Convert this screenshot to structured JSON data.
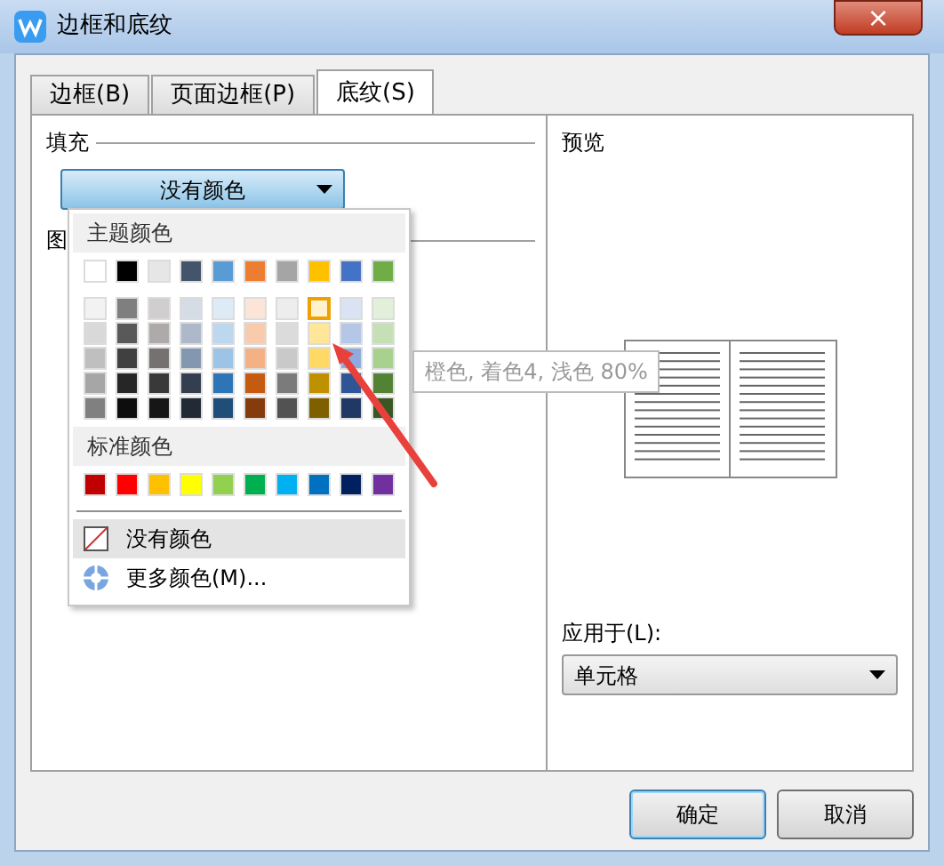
{
  "window": {
    "title": "边框和底纹",
    "close": "×"
  },
  "tabs": [
    {
      "label": "边框(B)",
      "selected": false
    },
    {
      "label": "页面边框(P)",
      "selected": false
    },
    {
      "label": "底纹(S)",
      "selected": true
    }
  ],
  "fill": {
    "label": "填充",
    "dropdown": "没有颜色"
  },
  "pattern": {
    "label": "图"
  },
  "color_menu": {
    "theme_heading": "主题颜色",
    "theme_colors": [
      {
        "color": "#ffffff"
      },
      {
        "color": "#000000"
      },
      {
        "color": "#e7e6e6"
      },
      {
        "color": "#44546a"
      },
      {
        "color": "#5b9bd5"
      },
      {
        "color": "#ed7d31"
      },
      {
        "color": "#a5a5a5"
      },
      {
        "color": "#ffc000"
      },
      {
        "color": "#4472c4"
      },
      {
        "color": "#70ad47"
      }
    ],
    "shades": [
      [
        {
          "color": "#f2f2f2",
          "selected": false
        },
        {
          "color": "#7f7f7f",
          "selected": false
        },
        {
          "color": "#d0cece",
          "selected": false
        },
        {
          "color": "#d6dce5",
          "selected": false
        },
        {
          "color": "#deebf7",
          "selected": false
        },
        {
          "color": "#fbe5d6",
          "selected": false
        },
        {
          "color": "#ededed",
          "selected": false
        },
        {
          "color": "#fff2cc",
          "selected": true
        },
        {
          "color": "#dae3f3",
          "selected": false
        },
        {
          "color": "#e2f0d9",
          "selected": false
        }
      ],
      [
        {
          "color": "#d9d9d9",
          "selected": false
        },
        {
          "color": "#595959",
          "selected": false
        },
        {
          "color": "#aeaaaa",
          "selected": false
        },
        {
          "color": "#adb9ca",
          "selected": false
        },
        {
          "color": "#bdd7ee",
          "selected": false
        },
        {
          "color": "#f8cbad",
          "selected": false
        },
        {
          "color": "#dbdbdb",
          "selected": false
        },
        {
          "color": "#ffe699",
          "selected": false
        },
        {
          "color": "#b4c7e7",
          "selected": false
        },
        {
          "color": "#c5e0b4",
          "selected": false
        }
      ],
      [
        {
          "color": "#bfbfbf",
          "selected": false
        },
        {
          "color": "#404040",
          "selected": false
        },
        {
          "color": "#757171",
          "selected": false
        },
        {
          "color": "#8497b0",
          "selected": false
        },
        {
          "color": "#9dc3e6",
          "selected": false
        },
        {
          "color": "#f4b183",
          "selected": false
        },
        {
          "color": "#c9c9c9",
          "selected": false
        },
        {
          "color": "#ffd966",
          "selected": false
        },
        {
          "color": "#8faadc",
          "selected": false
        },
        {
          "color": "#a9d18e",
          "selected": false
        }
      ],
      [
        {
          "color": "#a6a6a6",
          "selected": false
        },
        {
          "color": "#262626",
          "selected": false
        },
        {
          "color": "#3a3838",
          "selected": false
        },
        {
          "color": "#333f50",
          "selected": false
        },
        {
          "color": "#2e75b6",
          "selected": false
        },
        {
          "color": "#c55a11",
          "selected": false
        },
        {
          "color": "#7b7b7b",
          "selected": false
        },
        {
          "color": "#bf9000",
          "selected": false
        },
        {
          "color": "#2f5597",
          "selected": false
        },
        {
          "color": "#548235",
          "selected": false
        }
      ],
      [
        {
          "color": "#808080",
          "selected": false
        },
        {
          "color": "#0d0d0d",
          "selected": false
        },
        {
          "color": "#171616",
          "selected": false
        },
        {
          "color": "#222a35",
          "selected": false
        },
        {
          "color": "#1f4e79",
          "selected": false
        },
        {
          "color": "#843c0c",
          "selected": false
        },
        {
          "color": "#525252",
          "selected": false
        },
        {
          "color": "#7f6000",
          "selected": false
        },
        {
          "color": "#203864",
          "selected": false
        },
        {
          "color": "#385723",
          "selected": false
        }
      ]
    ],
    "standard_heading": "标准颜色",
    "standard_colors": [
      {
        "color": "#c00000"
      },
      {
        "color": "#ff0000"
      },
      {
        "color": "#ffc000"
      },
      {
        "color": "#ffff00"
      },
      {
        "color": "#92d050"
      },
      {
        "color": "#00b050"
      },
      {
        "color": "#00b0f0"
      },
      {
        "color": "#0070c0"
      },
      {
        "color": "#002060"
      },
      {
        "color": "#7030a0"
      }
    ],
    "items": [
      {
        "kind": "none",
        "label": "没有颜色",
        "selected": true
      },
      {
        "kind": "more",
        "label": "更多颜色(M)...",
        "selected": false
      }
    ]
  },
  "tooltip": "橙色, 着色4, 浅色 80%",
  "preview": {
    "label": "预览"
  },
  "apply_to": {
    "label": "应用于(L):",
    "value": "单元格"
  },
  "buttons": [
    {
      "label": "确定",
      "selected": true
    },
    {
      "label": "取消",
      "selected": false
    }
  ]
}
